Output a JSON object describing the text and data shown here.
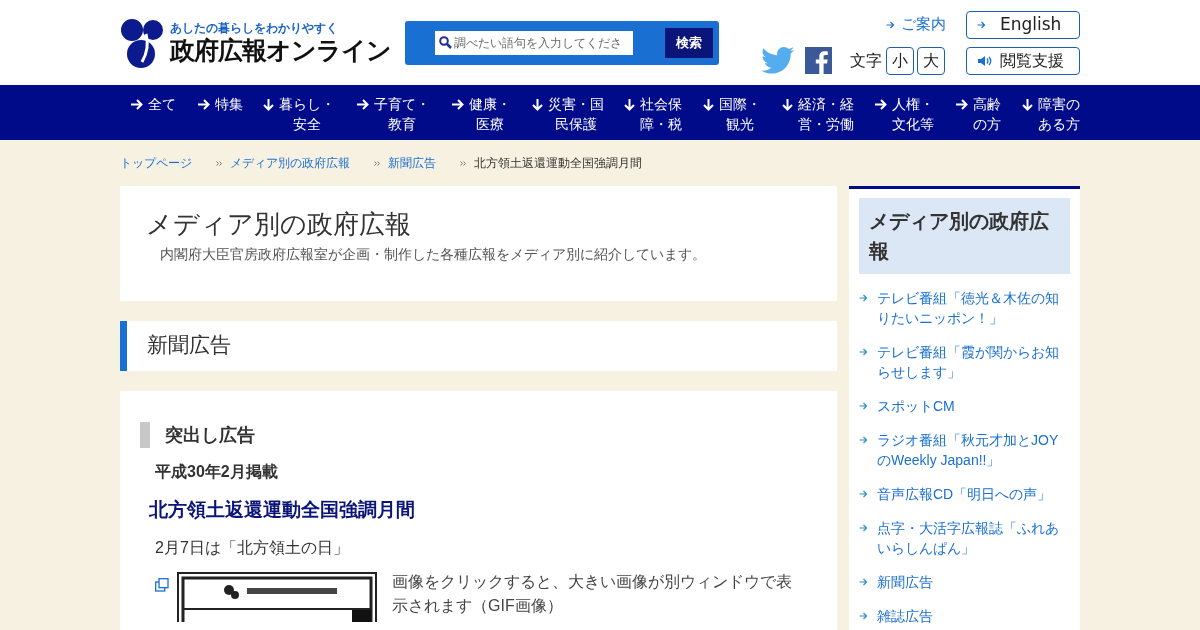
{
  "header": {
    "tagline": "あしたの暮らしをわかりやすく",
    "site_name": "政府広報オンライン",
    "search": {
      "placeholder": "調べたい語句を入力してくださ",
      "button": "検索"
    },
    "guide_link": "ご案内",
    "english_button": "English",
    "font_size": {
      "label": "文字",
      "small": "小",
      "large": "大"
    },
    "accessibility_button": "閲覧支援"
  },
  "nav": [
    {
      "kind": "right",
      "lines": [
        "全て"
      ]
    },
    {
      "kind": "right",
      "lines": [
        "特集"
      ]
    },
    {
      "kind": "down",
      "lines": [
        "暮らし・",
        "安全"
      ]
    },
    {
      "kind": "right",
      "lines": [
        "子育て・",
        "教育"
      ]
    },
    {
      "kind": "right",
      "lines": [
        "健康・",
        "医療"
      ]
    },
    {
      "kind": "down",
      "lines": [
        "災害・国",
        "民保護"
      ]
    },
    {
      "kind": "down",
      "lines": [
        "社会保",
        "障・税"
      ]
    },
    {
      "kind": "down",
      "lines": [
        "国際・",
        "観光"
      ]
    },
    {
      "kind": "down",
      "lines": [
        "経済・経",
        "営・労働"
      ]
    },
    {
      "kind": "right",
      "lines": [
        "人権・",
        "文化等"
      ]
    },
    {
      "kind": "right",
      "lines": [
        "高齢",
        "の方"
      ]
    },
    {
      "kind": "down",
      "lines": [
        "障害の",
        "ある方"
      ]
    }
  ],
  "breadcrumb": [
    {
      "label": "トップページ",
      "link": true
    },
    {
      "label": "メディア別の政府広報",
      "link": true
    },
    {
      "label": "新聞広告",
      "link": true
    },
    {
      "label": "北方領土返還運動全国強調月間",
      "link": false
    }
  ],
  "intro": {
    "title": "メディア別の政府広報",
    "description": "内閣府大臣官房政府広報室が企画・制作した各種広報をメディア別に紹介しています。"
  },
  "section_title": "新聞広告",
  "article": {
    "heading": "突出し広告",
    "date": "平成30年2月掲載",
    "title": "北方領土返還運動全国強調月間",
    "subtitle": "2月7日は「北方領土の日」",
    "image_note": "画像をクリックすると、大きい画像が別ウィンドウで表示されます（GIF画像）"
  },
  "sidebar": {
    "title": "メディア別の政府広報",
    "links": [
      "テレビ番組「徳光＆木佐の知りたいニッポン！」",
      "テレビ番組「霞が関からお知らせします」",
      "スポットCM",
      "ラジオ番組「秋元才加とJOYのWeekly Japan!!」",
      "音声広報CD「明日への声」",
      "点字・大活字広報誌「ふれあいらしんぱん」",
      "新聞広告",
      "雑誌広告"
    ]
  }
}
